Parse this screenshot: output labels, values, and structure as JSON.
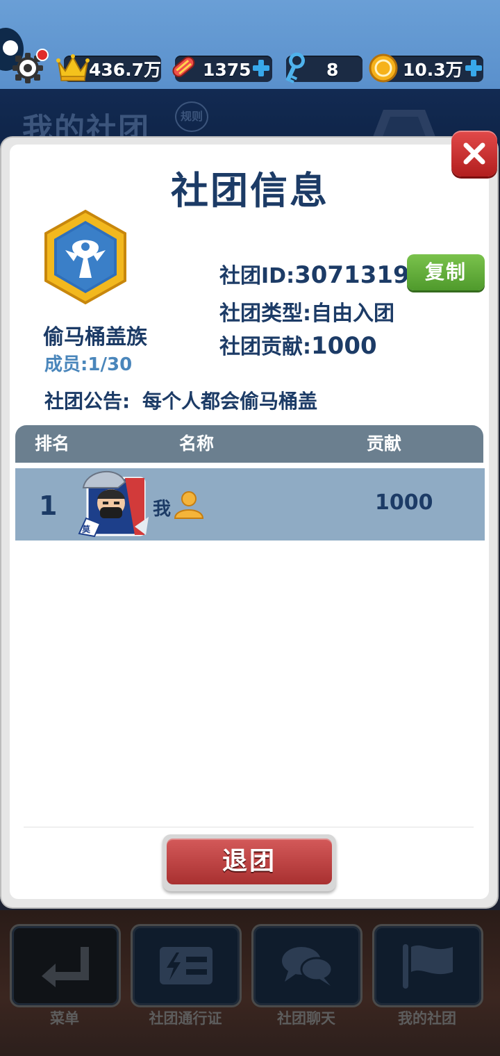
{
  "resources": {
    "crown_value": "436.7万",
    "skate_value": "1375",
    "key_value": "8",
    "coin_value": "10.3万"
  },
  "background": {
    "title": "我的社团",
    "rules_label": "规则"
  },
  "modal": {
    "title": "社团信息",
    "club_name": "偷马桶盖族",
    "members": "成员:1/30",
    "club_id_label": "社团ID:",
    "club_id_value": "3071319",
    "copy_label": "复制",
    "type_line": "社团类型:自由入团",
    "contribution_label": "社团贡献:",
    "contribution_value": "1000",
    "notice_label": "社团公告:",
    "notice_text": "每个人都会偷马桶盖",
    "table": {
      "headers": [
        "排名",
        "名称",
        "贡献"
      ],
      "rows": [
        {
          "rank": "1",
          "name": "我",
          "contribution": "1000"
        }
      ]
    },
    "quit_label": "退团"
  },
  "bottom_nav": [
    {
      "label": "菜单",
      "icon": "return-arrow-icon"
    },
    {
      "label": "社团通行证",
      "icon": "pass-card-icon"
    },
    {
      "label": "社团聊天",
      "icon": "chat-bubbles-icon"
    },
    {
      "label": "我的社团",
      "icon": "flag-icon"
    }
  ],
  "colors": {
    "title_navy": "#1c3b66",
    "copy_green": "#5fae36",
    "quit_red": "#c04444",
    "row_blue": "#8fabc4",
    "header_gray": "#6b7f8f"
  }
}
